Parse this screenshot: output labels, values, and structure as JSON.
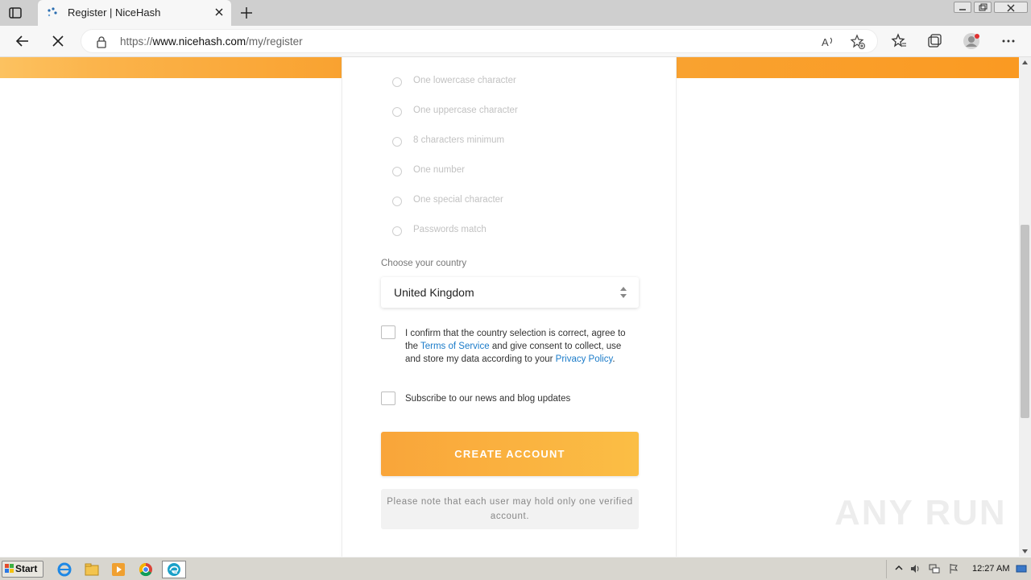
{
  "browser": {
    "tab_title": "Register | NiceHash",
    "url_prefix": "https://",
    "url_domain": "www.nicehash.com",
    "url_path": "/my/register"
  },
  "form": {
    "requirements": [
      "One lowercase character",
      "One uppercase character",
      "8 characters minimum",
      "One number",
      "One special character",
      "Passwords match"
    ],
    "country_label": "Choose your country",
    "country_value": "United Kingdom",
    "confirm_part1": "I confirm that the country selection is correct, agree to the ",
    "terms_link": "Terms of Service",
    "confirm_part2": " and give consent to collect, use and store my data according to your ",
    "privacy_link": "Privacy Policy",
    "confirm_part3": ".",
    "subscribe_label": "Subscribe to our news and blog updates",
    "create_button": "CREATE ACCOUNT",
    "note": "Please note that each user may hold only one verified account."
  },
  "watermark": "ANY RUN",
  "taskbar": {
    "start_label": "Start",
    "clock": "12:27 AM"
  },
  "colors": {
    "accent_orange": "#f9a230",
    "link_blue": "#1a7bc9"
  }
}
